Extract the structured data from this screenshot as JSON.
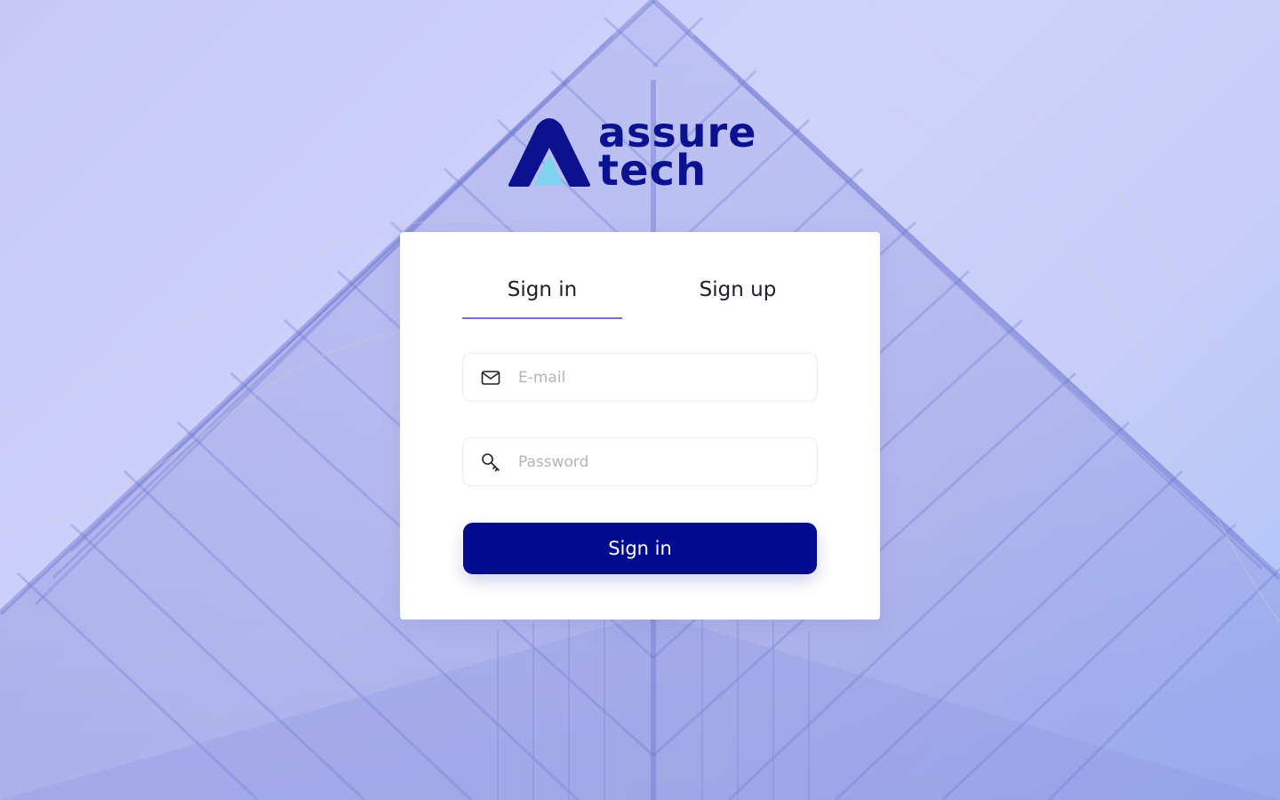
{
  "brand": {
    "line1": "assure",
    "line2": "tech",
    "primary_color": "#0b118f",
    "accent_color": "#7fd2f0"
  },
  "auth": {
    "tabs": [
      {
        "label": "Sign in",
        "active": true
      },
      {
        "label": "Sign up",
        "active": false
      }
    ],
    "email": {
      "placeholder": "E-mail",
      "value": "",
      "icon": "mail-icon"
    },
    "password": {
      "placeholder": "Password",
      "value": "",
      "icon": "key-icon"
    },
    "submit_label": "Sign in",
    "button_color": "#030b8f",
    "tab_underline_color": "#6f73d8"
  },
  "background": {
    "description_tint": "#c7c8f6"
  }
}
